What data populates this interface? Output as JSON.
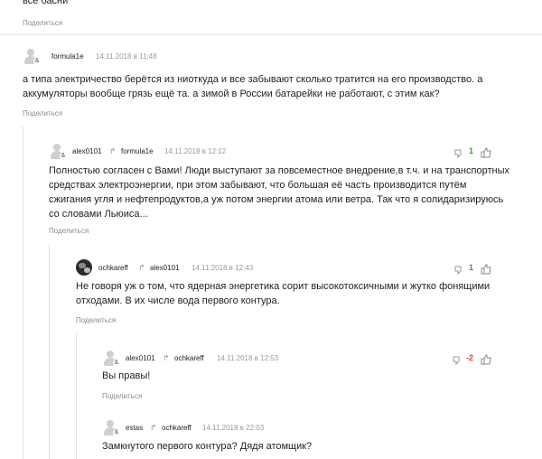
{
  "top": {
    "text": "все басни",
    "share": "Поделиться"
  },
  "comments": [
    {
      "author": "formula1e",
      "date": "14.11.2018 в 11:48",
      "text_lines": [
        "а типа электричество берётся из ниоткуда и все забывают сколько тратится на его производство. а",
        "аккумуляторы вообще грязь ещё та. а зимой в России батарейки не работают, с этим как?"
      ],
      "share": "Поделиться"
    },
    {
      "author": "alex0101",
      "reply_to": "formula1e",
      "date": "14.11.2018 в 12:12",
      "votes": "1",
      "text_lines": [
        "Полностью согласен с Вами! Люди выступают за повсеместное внедрение,в т.ч. и на транспортных",
        "средствах электроэнергии, при этом забывают, что большая её часть производится путём",
        "сжигания угля и нефтепродуктов,а уж потом энергии атома или ветра. Так что я солидаризируюсь",
        "со словами Льюиса..."
      ],
      "share": "Поделиться"
    },
    {
      "author": "ochkareff",
      "reply_to": "alex0101",
      "date": "14.11.2018 в 12:43",
      "votes": "1",
      "text_lines": [
        "Не говоря уж о том, что ядерная энергетика сорит высокотоксичными и жутко фонящими",
        "отходами. В их числе вода первого контура."
      ],
      "share": "Поделиться"
    },
    {
      "author": "alex0101",
      "reply_to": "ochkareff",
      "date": "14.11.2018 в 12:53",
      "votes": "-2",
      "text_lines": [
        "Вы правы!"
      ],
      "share": "Поделиться"
    },
    {
      "author": "estas",
      "reply_to": "ochkareff",
      "date": "14.11.2018 в 22:03",
      "text_lines": [
        "Замкнутого первого контура? Дядя атомщик?"
      ]
    }
  ],
  "colors": {
    "positive": "#3aa03a",
    "negative": "#e0383e",
    "muted": "#8a8a8a"
  },
  "icons": {
    "reply": "reply-arrow-icon",
    "thumb": "thumb-up-icon",
    "vote_down": "vote-down-icon",
    "badge": "social-badge-icon"
  }
}
